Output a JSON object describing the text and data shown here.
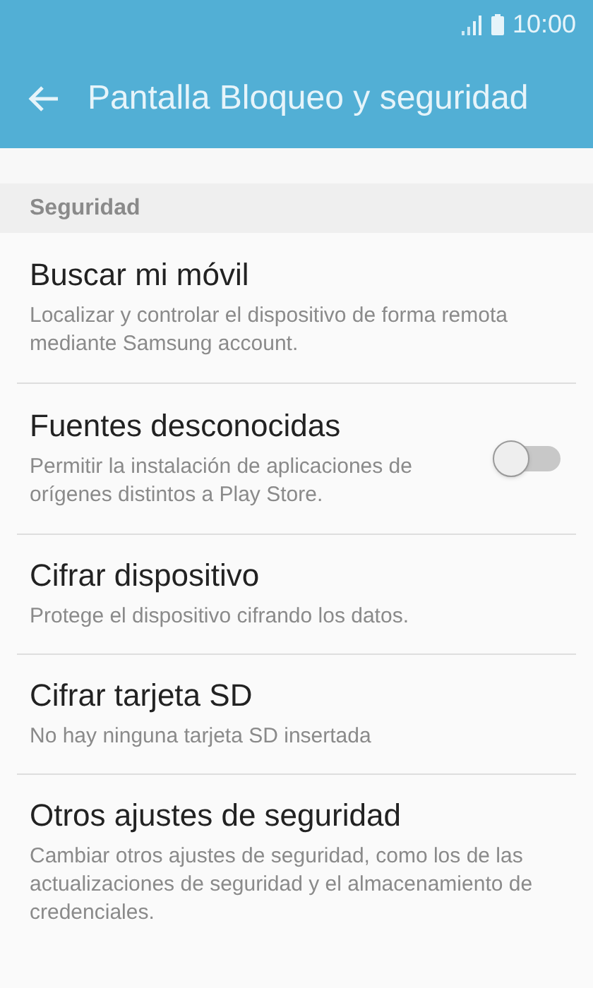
{
  "status_bar": {
    "time": "10:00"
  },
  "header": {
    "title": "Pantalla Bloqueo y seguridad"
  },
  "section": {
    "title": "Seguridad"
  },
  "items": [
    {
      "kind": "plain",
      "title": "Buscar mi móvil",
      "subtitle": "Localizar y controlar el dispositivo de forma remota mediante Samsung account."
    },
    {
      "kind": "switch",
      "title": "Fuentes desconocidas",
      "subtitle": "Permitir la instalación de aplicaciones de orígenes distintos a Play Store.",
      "on": false
    },
    {
      "kind": "plain",
      "title": "Cifrar dispositivo",
      "subtitle": "Protege el dispositivo cifrando los datos."
    },
    {
      "kind": "plain",
      "title": "Cifrar tarjeta SD",
      "subtitle": "No hay ninguna tarjeta SD insertada"
    },
    {
      "kind": "plain",
      "title": "Otros ajustes de seguridad",
      "subtitle": "Cambiar otros ajustes de seguridad, como los de las actualizaciones de seguridad y el almacenamiento de credenciales."
    }
  ]
}
